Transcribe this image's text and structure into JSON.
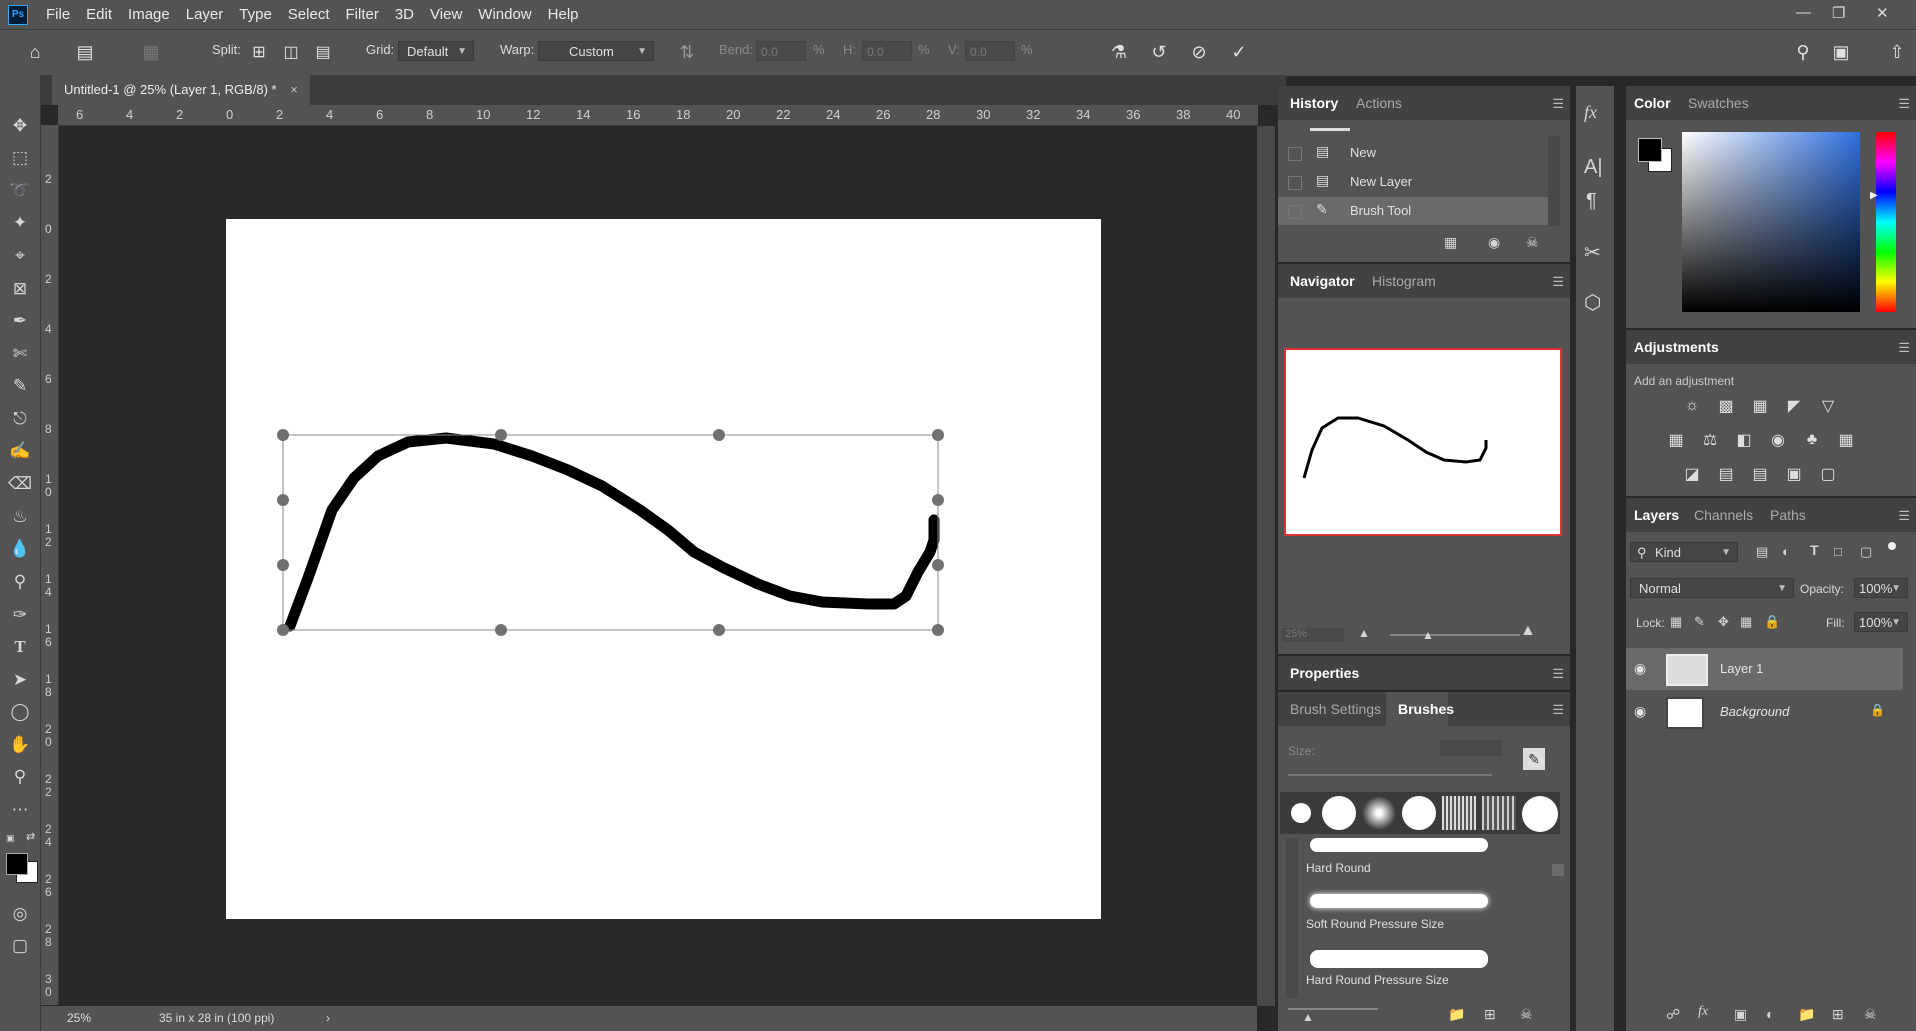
{
  "app": {
    "logo": "Ps"
  },
  "menu": [
    "File",
    "Edit",
    "Image",
    "Layer",
    "Type",
    "Select",
    "Filter",
    "3D",
    "View",
    "Window",
    "Help"
  ],
  "options": {
    "split_label": "Split:",
    "grid_label": "Grid:",
    "grid_value": "Default",
    "warp_label": "Warp:",
    "warp_value": "Custom",
    "bend_label": "Bend:",
    "bend_value": "0.0",
    "bend_unit": "%",
    "h_label": "H:",
    "h_value": "0.0",
    "h_unit": "%",
    "v_label": "V:",
    "v_value": "0.0",
    "v_unit": "%"
  },
  "document": {
    "tab_title": "Untitled-1 @ 25% (Layer 1, RGB/8) *",
    "close": "×",
    "zoom": "25%",
    "size_info": "35 in x 28 in (100 ppi)",
    "status_arrow": "›"
  },
  "ruler": {
    "top": [
      "6",
      "4",
      "2",
      "0",
      "2",
      "4",
      "6",
      "8",
      "10",
      "12",
      "14",
      "16",
      "18",
      "20",
      "22",
      "24",
      "26",
      "28",
      "30",
      "32",
      "34",
      "36",
      "38",
      "40"
    ],
    "left": [
      "2",
      "0",
      "2",
      "4",
      "6",
      "8",
      "1\n0",
      "1\n2",
      "1\n4",
      "1\n6",
      "1\n8",
      "2\n0",
      "2\n2",
      "2\n4",
      "2\n6",
      "2\n8",
      "3\n0"
    ]
  },
  "history": {
    "tabs": [
      "History",
      "Actions"
    ],
    "items": [
      {
        "label": "New",
        "icon": "document-icon"
      },
      {
        "label": "New Layer",
        "icon": "document-icon"
      },
      {
        "label": "Brush Tool",
        "icon": "brush-icon"
      }
    ]
  },
  "navigator": {
    "tabs": [
      "Navigator",
      "Histogram"
    ],
    "zoom": "25%"
  },
  "properties": {
    "title": "Properties"
  },
  "brushes": {
    "tabs": [
      "Brush Settings",
      "Brushes"
    ],
    "size_label": "Size:",
    "presets": [
      "Hard Round",
      "Soft Round Pressure Size",
      "Hard Round Pressure Size"
    ]
  },
  "color": {
    "tabs": [
      "Color",
      "Swatches"
    ],
    "foreground": "#000000",
    "background": "#ffffff"
  },
  "adjustments": {
    "title": "Adjustments",
    "subtitle": "Add an adjustment"
  },
  "layers": {
    "tabs": [
      "Layers",
      "Channels",
      "Paths"
    ],
    "filter": "Kind",
    "blend_mode": "Normal",
    "opacity_label": "Opacity:",
    "opacity": "100%",
    "lock_label": "Lock:",
    "fill_label": "Fill:",
    "fill": "100%",
    "items": [
      {
        "name": "Layer 1",
        "visible": true,
        "selected": true
      },
      {
        "name": "Background",
        "visible": true,
        "locked": true
      }
    ]
  }
}
